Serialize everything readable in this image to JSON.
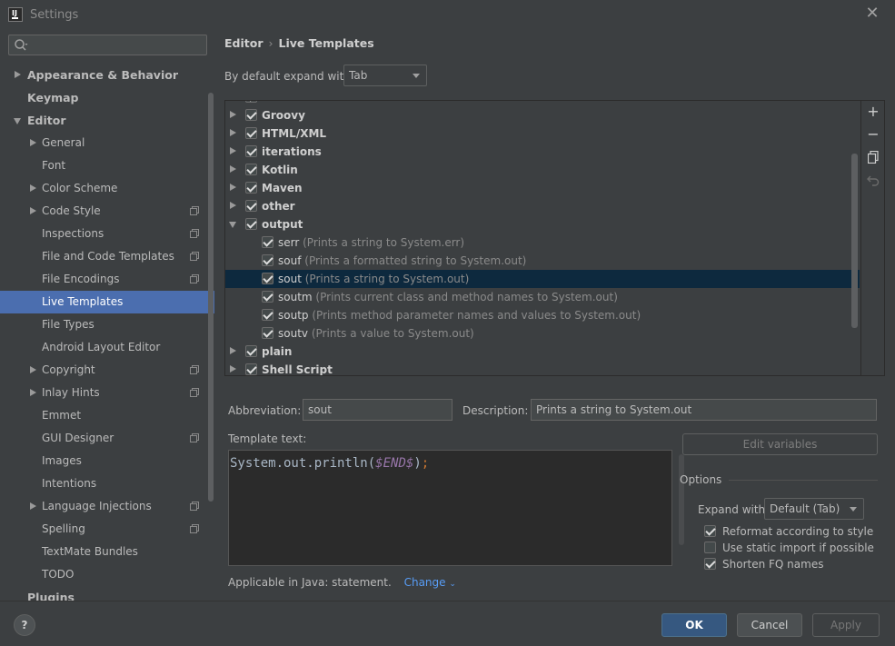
{
  "window": {
    "title": "Settings"
  },
  "search": {
    "placeholder": ""
  },
  "sidebar": {
    "items": [
      {
        "label": "Appearance & Behavior",
        "bold": true,
        "arrow": "right",
        "level": 0
      },
      {
        "label": "Keymap",
        "bold": true,
        "arrow": "none",
        "level": 0
      },
      {
        "label": "Editor",
        "bold": true,
        "arrow": "down",
        "level": 0
      },
      {
        "label": "General",
        "arrow": "right",
        "level": 1
      },
      {
        "label": "Font",
        "arrow": "none",
        "level": 1
      },
      {
        "label": "Color Scheme",
        "arrow": "right",
        "level": 1
      },
      {
        "label": "Code Style",
        "arrow": "right",
        "level": 1,
        "project_icon": true
      },
      {
        "label": "Inspections",
        "arrow": "none",
        "level": 1,
        "project_icon": true
      },
      {
        "label": "File and Code Templates",
        "arrow": "none",
        "level": 1,
        "project_icon": true
      },
      {
        "label": "File Encodings",
        "arrow": "none",
        "level": 1,
        "project_icon": true
      },
      {
        "label": "Live Templates",
        "arrow": "none",
        "level": 1,
        "selected": true
      },
      {
        "label": "File Types",
        "arrow": "none",
        "level": 1
      },
      {
        "label": "Android Layout Editor",
        "arrow": "none",
        "level": 1
      },
      {
        "label": "Copyright",
        "arrow": "right",
        "level": 1,
        "project_icon": true
      },
      {
        "label": "Inlay Hints",
        "arrow": "right",
        "level": 1,
        "project_icon": true
      },
      {
        "label": "Emmet",
        "arrow": "none",
        "level": 1
      },
      {
        "label": "GUI Designer",
        "arrow": "none",
        "level": 1,
        "project_icon": true
      },
      {
        "label": "Images",
        "arrow": "none",
        "level": 1
      },
      {
        "label": "Intentions",
        "arrow": "none",
        "level": 1
      },
      {
        "label": "Language Injections",
        "arrow": "right",
        "level": 1,
        "project_icon": true
      },
      {
        "label": "Spelling",
        "arrow": "none",
        "level": 1,
        "project_icon": true
      },
      {
        "label": "TextMate Bundles",
        "arrow": "none",
        "level": 1
      },
      {
        "label": "TODO",
        "arrow": "none",
        "level": 1
      },
      {
        "label": "Plugins",
        "bold": true,
        "arrow": "none",
        "level": 0
      }
    ]
  },
  "breadcrumb": {
    "parent": "Editor",
    "current": "Live Templates"
  },
  "expand": {
    "label": "By default expand with",
    "value": "Tab"
  },
  "templates": [
    {
      "name": "Groovy",
      "group": true,
      "arrow": "right",
      "checked": true
    },
    {
      "name": "HTML/XML",
      "group": true,
      "arrow": "right",
      "checked": true
    },
    {
      "name": "iterations",
      "group": true,
      "arrow": "right",
      "checked": true
    },
    {
      "name": "Kotlin",
      "group": true,
      "arrow": "right",
      "checked": true
    },
    {
      "name": "Maven",
      "group": true,
      "arrow": "right",
      "checked": true
    },
    {
      "name": "other",
      "group": true,
      "arrow": "right",
      "checked": true
    },
    {
      "name": "output",
      "group": true,
      "arrow": "down",
      "checked": true
    },
    {
      "name": "serr",
      "desc": "(Prints a string to System.err)",
      "checked": true
    },
    {
      "name": "souf",
      "desc": "(Prints a formatted string to System.out)",
      "checked": true
    },
    {
      "name": "sout",
      "desc": "(Prints a string to System.out)",
      "checked": true,
      "selected": true
    },
    {
      "name": "soutm",
      "desc": "(Prints current class and method names to System.out)",
      "checked": true
    },
    {
      "name": "soutp",
      "desc": "(Prints method parameter names and values to System.out)",
      "checked": true
    },
    {
      "name": "soutv",
      "desc": "(Prints a value to System.out)",
      "checked": true
    },
    {
      "name": "plain",
      "group": true,
      "arrow": "right",
      "checked": true
    },
    {
      "name": "Shell Script",
      "group": true,
      "arrow": "right",
      "checked": true
    }
  ],
  "tools": {
    "add": "+",
    "remove": "−",
    "copy_icon": "copy-icon",
    "restore_icon": "undo-icon"
  },
  "abbreviation": {
    "label": "Abbreviation:",
    "value": "sout"
  },
  "description": {
    "label": "Description:",
    "value": "Prints a string to System.out"
  },
  "template_text": {
    "label": "Template text:",
    "code_prefix": "System.out.println(",
    "code_var": "$END$",
    "code_suffix": ")",
    "code_semicolon": ";"
  },
  "applicable": {
    "text": "Applicable in Java: statement.",
    "link": "Change"
  },
  "edit_variables": "Edit variables",
  "options": {
    "title": "Options",
    "expand_label": "Expand with",
    "expand_value": "Default (Tab)",
    "checks": [
      {
        "label": "Reformat according to style",
        "checked": true
      },
      {
        "label": "Use static import if possible",
        "checked": false
      },
      {
        "label": "Shorten FQ names",
        "checked": true
      }
    ]
  },
  "footer": {
    "help": "?",
    "ok": "OK",
    "cancel": "Cancel",
    "apply": "Apply"
  }
}
